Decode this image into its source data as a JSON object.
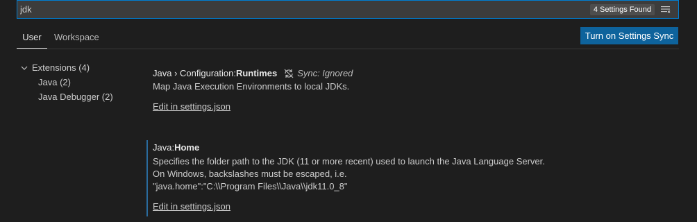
{
  "search": {
    "value": "jdk",
    "count_badge": "4 Settings Found"
  },
  "tabs": [
    {
      "label": "User"
    },
    {
      "label": "Workspace"
    }
  ],
  "sync_button": "Turn on Settings Sync",
  "toc": {
    "group_label": "Extensions (4)",
    "items": [
      {
        "label": "Java (2)"
      },
      {
        "label": "Java Debugger (2)"
      }
    ]
  },
  "settings": [
    {
      "category": "Java › Configuration: ",
      "name": "Runtimes",
      "sync_status": "Sync: Ignored",
      "description": "Map Java Execution Environments to local JDKs.",
      "edit_link": "Edit in settings.json"
    },
    {
      "category": "Java: ",
      "name": "Home",
      "description_lines": [
        "Specifies the folder path to the JDK (11 or more recent) used to launch the Java Language Server.",
        "On Windows, backslashes must be escaped, i.e.",
        "\"java.home\":\"C:\\\\Program Files\\\\Java\\\\jdk11.0_8\""
      ],
      "edit_link": "Edit in settings.json"
    }
  ],
  "colors": {
    "accent": "#007fd4",
    "button": "#0e639c",
    "background": "#1e1e1e"
  }
}
